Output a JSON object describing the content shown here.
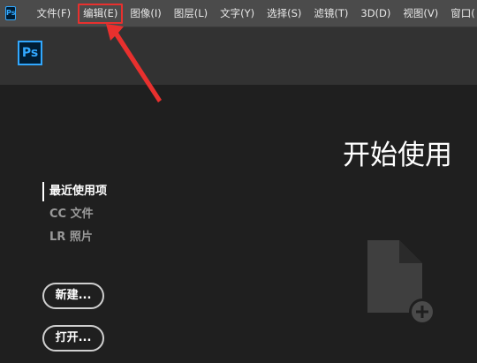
{
  "app": {
    "mini_logo": "Ps",
    "logo": "Ps"
  },
  "menu": {
    "items": [
      {
        "label": "文件(F)"
      },
      {
        "label": "编辑(E)"
      },
      {
        "label": "图像(I)"
      },
      {
        "label": "图层(L)"
      },
      {
        "label": "文字(Y)"
      },
      {
        "label": "选择(S)"
      },
      {
        "label": "滤镜(T)"
      },
      {
        "label": "3D(D)"
      },
      {
        "label": "视图(V)"
      },
      {
        "label": "窗口("
      }
    ],
    "highlighted_index": 1
  },
  "home": {
    "title": "开始使用",
    "nav": [
      {
        "label": "最近使用项",
        "active": true
      },
      {
        "label": "CC 文件",
        "active": false
      },
      {
        "label": "LR 照片",
        "active": false
      }
    ],
    "new_button": "新建...",
    "open_button": "打开..."
  },
  "annotation": {
    "color": "#e8302e",
    "arrow_icon": "red-arrow-icon"
  },
  "colors": {
    "menubar": "#4b4b4b",
    "band": "#323232",
    "background": "#1f1f1f",
    "brand": "#31a8ff"
  }
}
